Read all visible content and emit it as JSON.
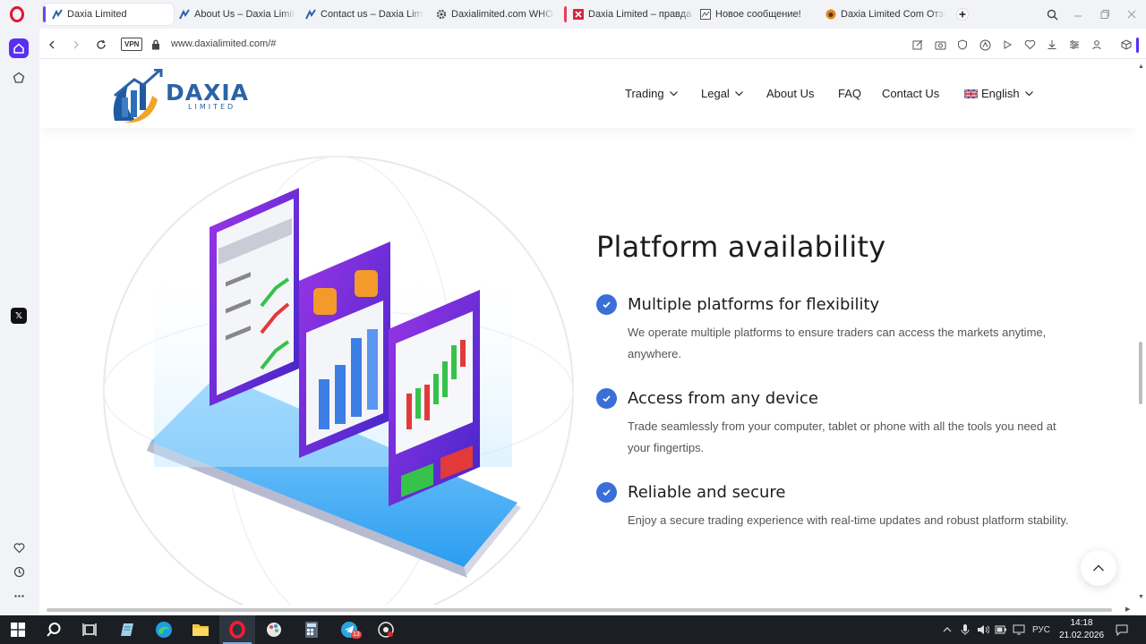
{
  "browser": {
    "tabs": [
      {
        "title": "Daxia Limited",
        "active": true,
        "mark_color": "#6b46e8"
      },
      {
        "title": "About Us – Daxia Limited",
        "active": false
      },
      {
        "title": "Contact us – Daxia Limited",
        "active": false
      },
      {
        "title": "Daxialimited.com WHOIS,",
        "active": false
      },
      {
        "title": "Daxia Limited – правда о",
        "active": false,
        "mark_color": "#e83b5a"
      },
      {
        "title": "Новое сообщение!",
        "active": false
      },
      {
        "title": "Daxia Limited Com Отзыв",
        "active": false
      }
    ],
    "url": "www.daxialimited.com/#",
    "vpn_label": "VPN"
  },
  "header": {
    "logo_word": "DAXIA",
    "logo_sub": "LIMITED",
    "nav": {
      "trading": "Trading",
      "legal": "Legal",
      "about": "About Us",
      "faq": "FAQ",
      "contact": "Contact Us",
      "language": "English"
    }
  },
  "section": {
    "title": "Platform availability",
    "features": [
      {
        "title": "Multiple platforms for flexibility",
        "desc": "We operate multiple platforms to ensure traders can access the markets anytime, anywhere."
      },
      {
        "title": "Access from any device",
        "desc": "Trade seamlessly from your computer, tablet or phone with all the tools you need at your fingertips."
      },
      {
        "title": "Reliable and secure",
        "desc": "Enjoy a secure trading experience with real-time updates and robust platform stability."
      }
    ]
  },
  "taskbar": {
    "language": "РУС",
    "time": "14:18",
    "date": "21.02.2026",
    "telegram_badge": "13"
  },
  "colors": {
    "accent": "#3a6fd8",
    "brand": "#2b63a6",
    "opera_purple": "#5a2ff2"
  }
}
